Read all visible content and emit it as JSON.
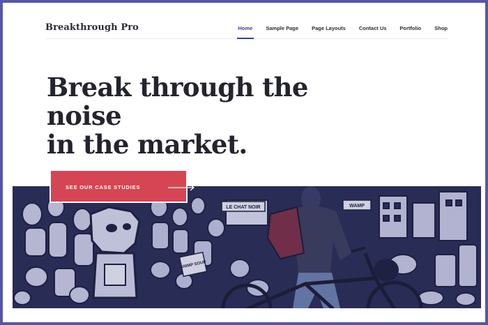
{
  "site": {
    "title": "Breakthrough Pro"
  },
  "nav": {
    "items": [
      {
        "label": "Home",
        "active": true
      },
      {
        "label": "Sample Page",
        "active": false
      },
      {
        "label": "Page Layouts",
        "active": false
      },
      {
        "label": "Contact Us",
        "active": false
      },
      {
        "label": "Portfolio",
        "active": false
      },
      {
        "label": "Shop",
        "active": false
      }
    ]
  },
  "hero": {
    "headline_line1": "Break through the noise",
    "headline_line2": "in the market.",
    "cta_label": "SEE OUR CASE STUDIES",
    "image": {
      "alt": "",
      "mural_sign_1": "LE CHAT NOIR",
      "mural_sign_2": "WAMP",
      "mural_sign_3": "SNIMP SOUP"
    }
  },
  "colors": {
    "frame": "#5457a8",
    "accent": "#3a3f9a",
    "cta": "#d64554",
    "heading": "#24242e",
    "image_tint": "#2a2d55"
  },
  "icons": {
    "cta_arrow": "long-arrow-right-icon"
  }
}
